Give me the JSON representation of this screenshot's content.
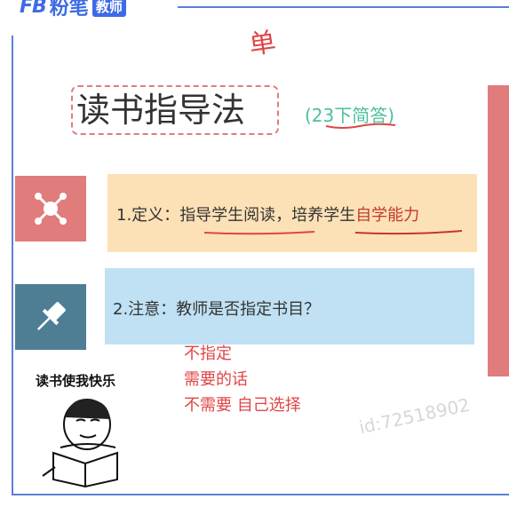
{
  "logo": {
    "mark": "FB",
    "name": "粉笔",
    "badge": "教师"
  },
  "handwriting": {
    "top_mark": "单"
  },
  "title": {
    "main": "读书指导法",
    "note": "(23下简答)"
  },
  "definition": {
    "prefix": "1.定义：",
    "part1": "指导学生阅读，培养学生",
    "part2": "自学能力"
  },
  "notice": {
    "text": "2.注意：教师是否指定书目？"
  },
  "answers": [
    "不指定",
    "需要的话",
    "不需要  自己选择"
  ],
  "meme": {
    "caption": "读书使我快乐"
  },
  "watermark": "id:72518902",
  "icons": {
    "definition": "network-icon",
    "notice": "pushpin-icon"
  },
  "colors": {
    "frame": "#5b7fd6",
    "accent_red": "#e07c7c",
    "definition_bg": "#fde1b6",
    "notice_bg": "#bfe1f3",
    "note_green": "#4cbf9a",
    "handwriting_red": "#e04545"
  }
}
